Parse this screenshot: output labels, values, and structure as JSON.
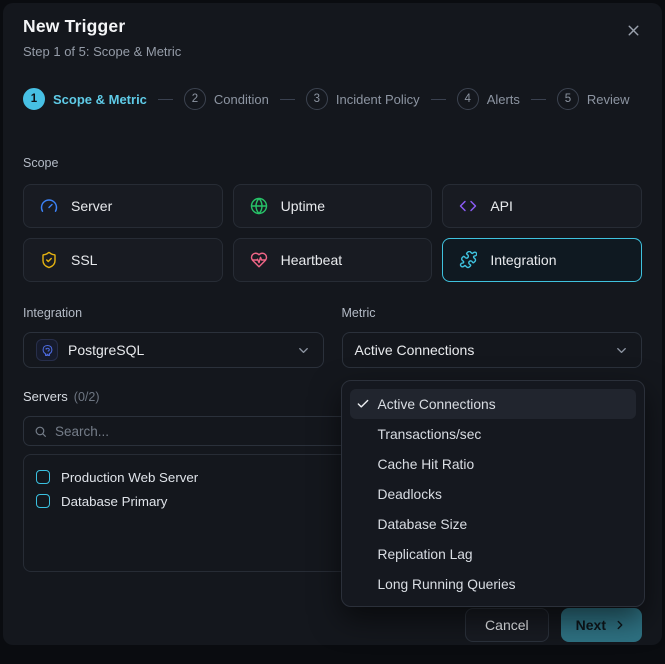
{
  "modal": {
    "title": "New Trigger",
    "subtitle": "Step 1 of 5: Scope & Metric"
  },
  "stepper": {
    "steps": [
      {
        "num": "1",
        "label": "Scope & Metric",
        "active": true
      },
      {
        "num": "2",
        "label": "Condition",
        "active": false
      },
      {
        "num": "3",
        "label": "Incident Policy",
        "active": false
      },
      {
        "num": "4",
        "label": "Alerts",
        "active": false
      },
      {
        "num": "5",
        "label": "Review",
        "active": false
      }
    ]
  },
  "scope": {
    "label": "Scope",
    "options": [
      {
        "label": "Server",
        "icon": "gauge-icon",
        "color": "#3b82f6",
        "selected": false
      },
      {
        "label": "Uptime",
        "icon": "globe-icon",
        "color": "#27c268",
        "selected": false
      },
      {
        "label": "API",
        "icon": "code-brackets-icon",
        "color": "#8b5cf6",
        "selected": false
      },
      {
        "label": "SSL",
        "icon": "shield-check-icon",
        "color": "#e3b111",
        "selected": false
      },
      {
        "label": "Heartbeat",
        "icon": "heart-pulse-icon",
        "color": "#ef6586",
        "selected": false
      },
      {
        "label": "Integration",
        "icon": "puzzle-icon",
        "color": "#3fc2de",
        "selected": true
      }
    ]
  },
  "integration": {
    "label": "Integration",
    "value": "PostgreSQL"
  },
  "metric": {
    "label": "Metric",
    "value": "Active Connections",
    "menu": {
      "items": [
        "Active Connections",
        "Transactions/sec",
        "Cache Hit Ratio",
        "Deadlocks",
        "Database Size",
        "Replication Lag",
        "Long Running Queries"
      ],
      "selected_index": 0
    }
  },
  "servers": {
    "label": "Servers",
    "count": "(0/2)",
    "search_placeholder": "Search...",
    "items": [
      {
        "name": "Production Web Server",
        "checked": false
      },
      {
        "name": "Database Primary",
        "checked": false
      }
    ]
  },
  "footer": {
    "cancel_label": "Cancel",
    "next_label": "Next"
  },
  "colors": {
    "accent_cyan": "#3fc2de",
    "step_active": "#47c0e4",
    "next_button_bg": "#2e7182",
    "postgres_blue": "#4d6be0",
    "modal_bg": "#14171d",
    "card_bg": "#181b22"
  }
}
